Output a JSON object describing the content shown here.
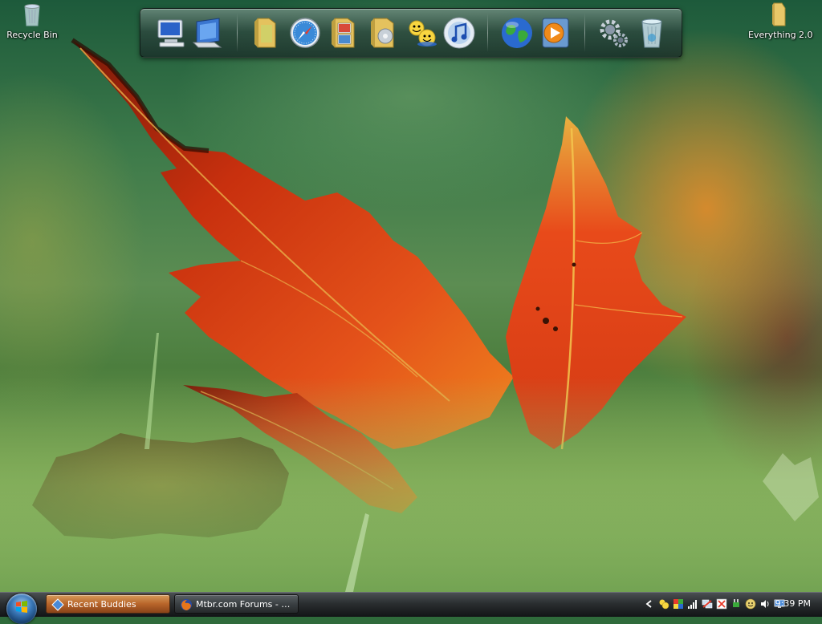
{
  "desktop": {
    "icons": [
      {
        "label": "Recycle Bin",
        "icon": "recycle-bin-icon"
      },
      {
        "label": "Everything 2.0",
        "icon": "folder-icon"
      }
    ]
  },
  "dock": {
    "items": [
      {
        "icon": "my-computer-icon"
      },
      {
        "icon": "control-panel-icon"
      },
      {
        "icon": "documents-folder-icon"
      },
      {
        "icon": "safari-compass-icon"
      },
      {
        "icon": "pictures-folder-icon"
      },
      {
        "icon": "music-folder-icon"
      },
      {
        "icon": "messenger-buddies-icon"
      },
      {
        "icon": "itunes-icon"
      },
      {
        "icon": "globe-browser-icon"
      },
      {
        "icon": "media-player-icon"
      },
      {
        "icon": "settings-gears-icon"
      },
      {
        "icon": "recycle-bin-icon"
      }
    ]
  },
  "taskbar": {
    "start": {
      "icon": "windows-start-orb-icon"
    },
    "tasks": [
      {
        "label": "Recent Buddies",
        "icon": "diamond-app-icon",
        "active": true
      },
      {
        "label": "Mtbr.com Forums - Us...",
        "icon": "firefox-icon",
        "active": false
      }
    ],
    "tray": {
      "icons": [
        "chevron-left-icon",
        "messenger-tray-icon",
        "color-squares-icon",
        "signal-bars-icon",
        "network-icon",
        "security-icon",
        "plug-icon",
        "smiley-icon",
        "volume-icon",
        "display-icon"
      ],
      "clock": "9:39 PM"
    }
  },
  "colors": {
    "leaf_red": "#d63a12",
    "leaf_orange": "#f07a1a",
    "taskbar_dark": "#1a1d1f",
    "active_task": "#b8652a"
  }
}
